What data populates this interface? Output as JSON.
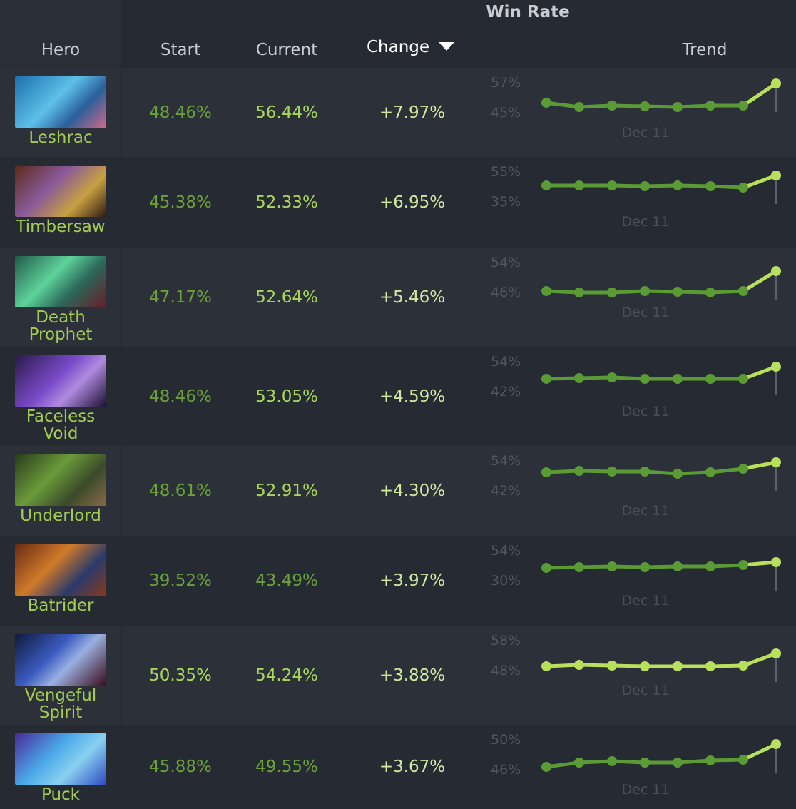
{
  "header": {
    "hero": "Hero",
    "start": "Start",
    "current": "Current",
    "change": "Change",
    "win_rate": "Win Rate",
    "trend": "Trend"
  },
  "colors": {
    "green_dim": "#5a9b35",
    "green_bright": "#b8e05a",
    "hero_name": "#a3cc52"
  },
  "rows": [
    {
      "hero": [
        "Leshrac"
      ],
      "start": "48.46%",
      "current": "56.44%",
      "change": "+7.97%",
      "y_top": "57%",
      "y_bottom": "45%",
      "date": "Dec 11",
      "start_tone": "dim",
      "current_tone": "bright",
      "line_tone": "dim",
      "portrait": "leshrac-portrait"
    },
    {
      "hero": [
        "Timbersaw"
      ],
      "start": "45.38%",
      "current": "52.33%",
      "change": "+6.95%",
      "y_top": "55%",
      "y_bottom": "35%",
      "date": "Dec 11",
      "start_tone": "dim",
      "current_tone": "bright",
      "line_tone": "dim",
      "portrait": "timbersaw-portrait"
    },
    {
      "hero": [
        "Death",
        "Prophet"
      ],
      "start": "47.17%",
      "current": "52.64%",
      "change": "+5.46%",
      "y_top": "54%",
      "y_bottom": "46%",
      "date": "Dec 11",
      "start_tone": "dim",
      "current_tone": "bright",
      "line_tone": "dim",
      "portrait": "death-prophet-portrait"
    },
    {
      "hero": [
        "Faceless",
        "Void"
      ],
      "start": "48.46%",
      "current": "53.05%",
      "change": "+4.59%",
      "y_top": "54%",
      "y_bottom": "42%",
      "date": "Dec 11",
      "start_tone": "dim",
      "current_tone": "bright",
      "line_tone": "dim",
      "portrait": "faceless-void-portrait"
    },
    {
      "hero": [
        "Underlord"
      ],
      "start": "48.61%",
      "current": "52.91%",
      "change": "+4.30%",
      "y_top": "54%",
      "y_bottom": "42%",
      "date": "Dec 11",
      "start_tone": "dim",
      "current_tone": "bright",
      "line_tone": "dim",
      "portrait": "underlord-portrait"
    },
    {
      "hero": [
        "Batrider"
      ],
      "start": "39.52%",
      "current": "43.49%",
      "change": "+3.97%",
      "y_top": "54%",
      "y_bottom": "30%",
      "date": "Dec 11",
      "start_tone": "dim",
      "current_tone": "dim",
      "line_tone": "dim",
      "portrait": "batrider-portrait"
    },
    {
      "hero": [
        "Vengeful",
        "Spirit"
      ],
      "start": "50.35%",
      "current": "54.24%",
      "change": "+3.88%",
      "y_top": "58%",
      "y_bottom": "48%",
      "date": "Dec 11",
      "start_tone": "bright",
      "current_tone": "bright",
      "line_tone": "bright",
      "portrait": "vengeful-spirit-portrait"
    },
    {
      "hero": [
        "Puck"
      ],
      "start": "45.88%",
      "current": "49.55%",
      "change": "+3.67%",
      "y_top": "50%",
      "y_bottom": "46%",
      "date": "Dec 11",
      "start_tone": "dim",
      "current_tone": "dim",
      "line_tone": "dim",
      "portrait": "puck-portrait"
    }
  ]
}
